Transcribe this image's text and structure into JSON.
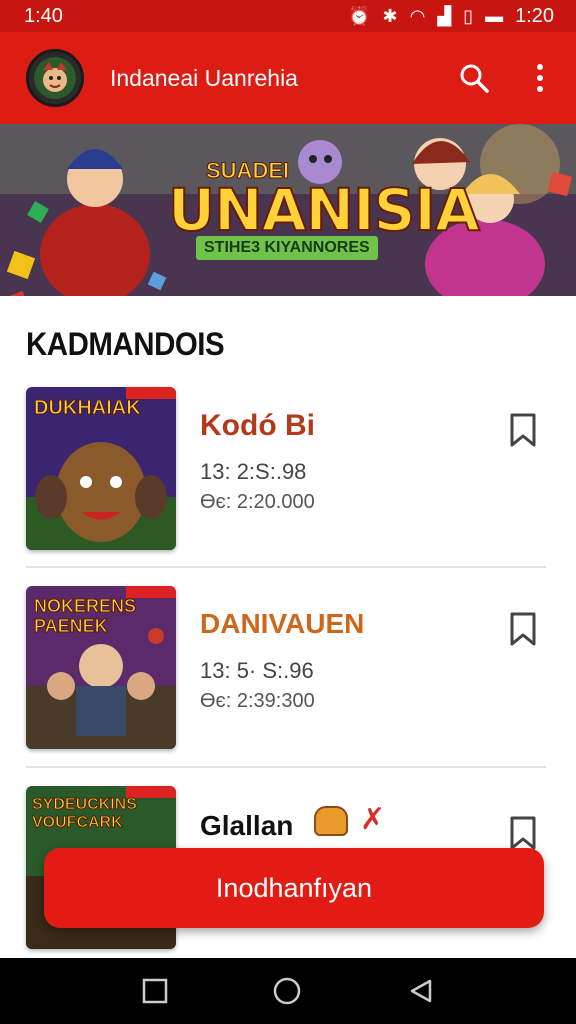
{
  "status_bar": {
    "time": "1:40",
    "clock_right": "1:20",
    "icons": [
      "alarm-icon",
      "bluetooth-icon",
      "wifi-icon",
      "signal-icon",
      "sim-icon",
      "battery-icon"
    ]
  },
  "app_bar": {
    "title": "Indaneai Uanrehia",
    "avatar_icon": "mascot-avatar-icon",
    "search_icon": "search-icon",
    "menu_icon": "more-vert-icon"
  },
  "banner": {
    "title": "UNANISIA",
    "kicker": "SUADEI",
    "subtitle": "STIHE3 KIYANNORES"
  },
  "section": {
    "title": "KADMANDOIS"
  },
  "games": [
    {
      "thumb_title": "DUKHAIAK",
      "name": "Kodó Bi",
      "meta1": "13: 2:S:.98",
      "meta2": "Өє: 2:20.000",
      "name_color": "#c0392b"
    },
    {
      "thumb_title": "NOKERENS PAENEK",
      "name": "DANIVAUEN",
      "meta1": "13: 5· S:.96",
      "meta2": "Өє: 2:39:300",
      "name_color": "#d0661a"
    },
    {
      "thumb_title": "SYDEUCKINS VOUFCARK",
      "name": "Glallan",
      "meta1": "",
      "meta2": "",
      "name_color": "#111111"
    }
  ],
  "primary_button": {
    "label": "Inodhanfıyan"
  },
  "nav": {
    "items": [
      "recent-apps-icon",
      "home-icon",
      "back-icon"
    ]
  },
  "colors": {
    "accent": "#dd1d14",
    "status": "#c8150f"
  }
}
